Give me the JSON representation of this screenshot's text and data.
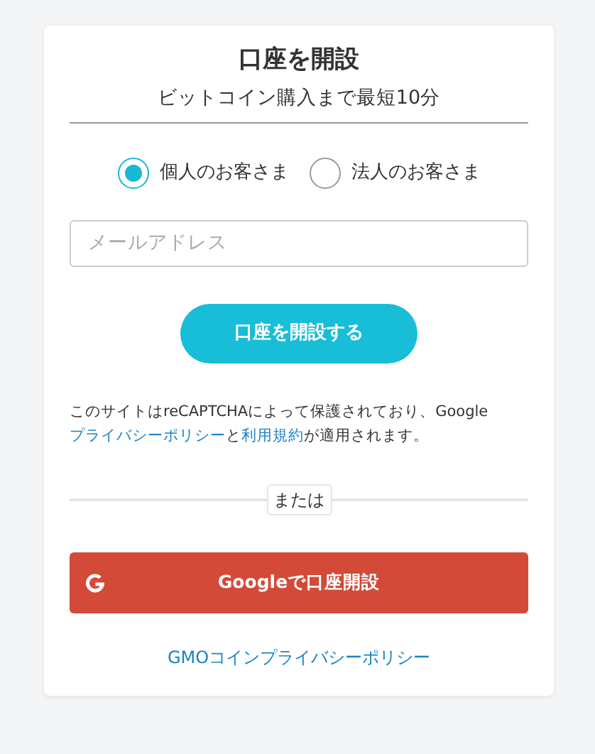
{
  "title": "口座を開設",
  "subtitle": "ビットコイン購入まで最短10分",
  "account_types": [
    {
      "label": "個人のお客さま",
      "selected": true
    },
    {
      "label": "法人のお客さま",
      "selected": false
    }
  ],
  "email_field": {
    "placeholder": "メールアドレス"
  },
  "submit_button": "口座を開設する",
  "recaptcha_notice": [
    {
      "kind": "text",
      "text": "このサイトはreCAPTCHAによって保護されており、Google"
    },
    {
      "kind": "link",
      "text": "プライバシーポリシー"
    },
    {
      "kind": "text",
      "text": "と"
    },
    {
      "kind": "link",
      "text": "利用規約"
    },
    {
      "kind": "text",
      "text": "が適用されます。"
    }
  ],
  "divider_label": "または",
  "google_button": "Googleで口座開設",
  "privacy_link": "GMOコインプライバシーポリシー"
}
